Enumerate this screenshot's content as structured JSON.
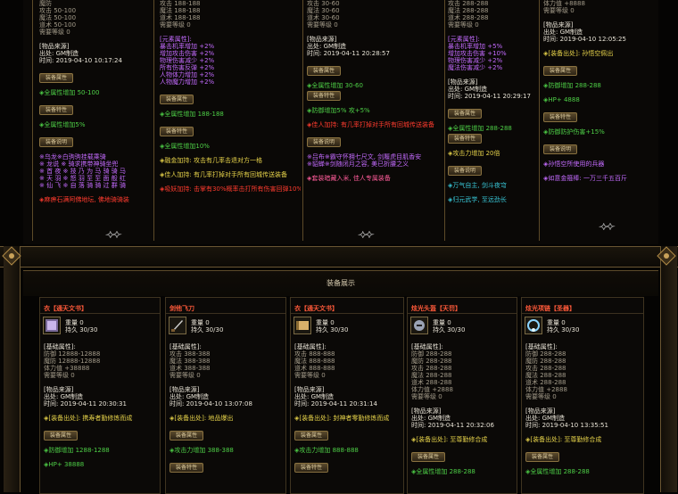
{
  "top_cols": [
    {
      "lines": [
        [
          "dim",
          "魔防"
        ],
        [
          "dim",
          "攻击          50-100"
        ],
        [
          "dim",
          "魔法          50-100"
        ],
        [
          "dim",
          "道术          50-100"
        ],
        [
          "dim",
          "需要等级        0"
        ],
        [
          "gap",
          ""
        ],
        [
          "white",
          "[物品来源]"
        ],
        [
          "white",
          "出处: GM制造"
        ],
        [
          "white",
          "时间: 2019-04-10 10:17:24"
        ],
        [
          "gap",
          ""
        ],
        [
          "btn",
          "装备属性"
        ],
        [
          "gap",
          ""
        ],
        [
          "green",
          "◈全属性增加 50-100"
        ],
        [
          "gap",
          ""
        ],
        [
          "btn",
          "装备特性"
        ],
        [
          "gap",
          ""
        ],
        [
          "green",
          "◈全属性增加5%"
        ],
        [
          "gap",
          ""
        ],
        [
          "btn",
          "装备说明"
        ],
        [
          "gap",
          ""
        ],
        [
          "purple",
          "※乌龙※白驹驹挂载乘骑"
        ],
        [
          "purple",
          "※ 龙说 ※ 骑求携带神骑坐兜"
        ],
        [
          "purple",
          "※ 首 夜 ※ 技 乃 为 马 骑 骑 马"
        ],
        [
          "purple",
          "※ 天 羽 ※ 怒 羽 至 至 面 般 红"
        ],
        [
          "purple",
          "※ 仙 飞 ※ 自 落 骑 骑 过 群 骑"
        ],
        [
          "gap",
          ""
        ],
        [
          "red",
          "◈麻痹石满阿佛地坛, 佛地骑骑装"
        ]
      ]
    },
    {
      "lines": [
        [
          "dim",
          "攻击          188-188"
        ],
        [
          "dim",
          "魔法          188-188"
        ],
        [
          "dim",
          "道术          188-188"
        ],
        [
          "dim",
          "需要等级        0"
        ],
        [
          "gap",
          ""
        ],
        [
          "purple",
          "[元素属性]:"
        ],
        [
          "purple",
          "暴击机率增加   +2%"
        ],
        [
          "purple",
          "增加攻击伤害   +2%"
        ],
        [
          "purple",
          "物理伤害减少   +2%"
        ],
        [
          "purple",
          "所有伤害反弹   +2%"
        ],
        [
          "purple",
          "人物体力增加   +2%"
        ],
        [
          "purple",
          "人物魔力增加   +2%"
        ],
        [
          "gap",
          ""
        ],
        [
          "btn",
          "装备属性"
        ],
        [
          "gap",
          ""
        ],
        [
          "green",
          "◈全属性增加 188-188"
        ],
        [
          "gap",
          ""
        ],
        [
          "btn",
          "装备特性"
        ],
        [
          "gap",
          ""
        ],
        [
          "green",
          "◈全属性增加10%"
        ],
        [
          "gap",
          ""
        ],
        [
          "yellow",
          "◈融金加持: 攻击有几率击退对方一格"
        ],
        [
          "gap",
          ""
        ],
        [
          "yellow",
          "◈佳人加持: 有几率打掉对手所有回城传送装备"
        ],
        [
          "gap",
          ""
        ],
        [
          "red",
          "◈吸妖加持: 击掌有30%概率击打所有伤害回弹10%"
        ]
      ]
    },
    {
      "lines": [
        [
          "dim",
          "攻击          30-60"
        ],
        [
          "dim",
          "魔法          30-60"
        ],
        [
          "dim",
          "道术          30-60"
        ],
        [
          "dim",
          "需要等级        0"
        ],
        [
          "gap",
          ""
        ],
        [
          "white",
          "[物品来源]"
        ],
        [
          "white",
          "出处: GM制造"
        ],
        [
          "white",
          "时间: 2019-04-11 20:28:57"
        ],
        [
          "gap",
          ""
        ],
        [
          "btn",
          "装备属性"
        ],
        [
          "gap",
          ""
        ],
        [
          "green",
          "◈全属性增加 30-60"
        ],
        [
          "btn",
          "装备特性"
        ],
        [
          "gap",
          ""
        ],
        [
          "green",
          "◈防御增加5% 攻+5%"
        ],
        [
          "gap",
          ""
        ],
        [
          "red",
          "◈佳人加持: 有几率打掉对手所有回城传送装备"
        ],
        [
          "gap",
          ""
        ],
        [
          "btn",
          "装备说明"
        ],
        [
          "gap",
          ""
        ],
        [
          "purple",
          "※吕布※霸守怀拥七尺文, 剑履虎目肌香安"
        ],
        [
          "purple",
          "※貂蝉※剑随闭月之容, 美已折腰之义"
        ],
        [
          "gap",
          ""
        ],
        [
          "pink",
          "◈套装暗藏入米, 佳人专属装备"
        ]
      ]
    },
    {
      "lines": [
        [
          "dim",
          "攻击          288-288"
        ],
        [
          "dim",
          "魔法          288-288"
        ],
        [
          "dim",
          "道术          288-288"
        ],
        [
          "dim",
          "需要等级        0"
        ],
        [
          "gap",
          ""
        ],
        [
          "purple",
          "[元素属性]:"
        ],
        [
          "purple",
          "暴击机率增加   +5%"
        ],
        [
          "purple",
          "增加攻击伤害   +10%"
        ],
        [
          "purple",
          "物理伤害减少   +2%"
        ],
        [
          "purple",
          "魔法伤害减少   +2%"
        ],
        [
          "gap",
          ""
        ],
        [
          "white",
          "[物品来源]"
        ],
        [
          "white",
          "出处: GM制造"
        ],
        [
          "white",
          "时间: 2019-04-11 20:29:17"
        ],
        [
          "gap",
          ""
        ],
        [
          "btn",
          "装备属性"
        ],
        [
          "gap",
          ""
        ],
        [
          "green",
          "◈全属性增加 288-288"
        ],
        [
          "btn",
          "装备特性"
        ],
        [
          "gap",
          ""
        ],
        [
          "yellow",
          "◈攻击力增加 20倍"
        ],
        [
          "gap",
          ""
        ],
        [
          "btn",
          "装备说明"
        ],
        [
          "gap",
          ""
        ],
        [
          "cyan",
          "◈万气自主, 剑斗夜穹"
        ],
        [
          "gap",
          ""
        ],
        [
          "cyan",
          "◈归元武学, 至远劲长"
        ]
      ]
    },
    {
      "lines": [
        [
          "dim",
          "体力值        +8888"
        ],
        [
          "dim",
          "需要等级        0"
        ],
        [
          "gap",
          ""
        ],
        [
          "white",
          "[物品来源]"
        ],
        [
          "white",
          "出处: GM制造"
        ],
        [
          "white",
          "时间: 2019-04-10 12:05:25"
        ],
        [
          "gap",
          ""
        ],
        [
          "yellow",
          "◈[装备出处]: 孙悟空佩出"
        ],
        [
          "gap",
          ""
        ],
        [
          "btn",
          "装备属性"
        ],
        [
          "gap",
          ""
        ],
        [
          "green",
          "◈防御增加 288-288"
        ],
        [
          "gap",
          ""
        ],
        [
          "green",
          "◈HP+ 4888"
        ],
        [
          "gap",
          ""
        ],
        [
          "btn",
          "装备特性"
        ],
        [
          "gap",
          ""
        ],
        [
          "green",
          "◈防御防护伤害+15%"
        ],
        [
          "gap",
          ""
        ],
        [
          "btn",
          "装备说明"
        ],
        [
          "gap",
          ""
        ],
        [
          "purple",
          "◈孙悟空所使用的兵器"
        ],
        [
          "gap",
          ""
        ],
        [
          "purple",
          "◈如意金箍棒: 一万三千五百斤"
        ]
      ]
    }
  ],
  "section_title": "装备展示",
  "cards": [
    {
      "name": "衣【通天文书】",
      "icon": "book-icon",
      "meta": [
        "重量 0",
        "持久 30/30"
      ],
      "lines": [
        [
          "white",
          "[基础属性]:"
        ],
        [
          "dim",
          "防御          12888-12888"
        ],
        [
          "dim",
          "魔防          12888-12888"
        ],
        [
          "dim",
          "体力值        +38888"
        ],
        [
          "dim",
          "需要等级        0"
        ],
        [
          "gap",
          ""
        ],
        [
          "white",
          "[物品来源]"
        ],
        [
          "white",
          "出处: GM制造"
        ],
        [
          "white",
          "时间: 2019-04-11 20:30:31"
        ],
        [
          "gap",
          ""
        ],
        [
          "yellow",
          "◈[装备出处]: 携寿者勤修炼而成"
        ],
        [
          "gap",
          ""
        ],
        [
          "btn",
          "装备属性"
        ],
        [
          "gap",
          ""
        ],
        [
          "green",
          "◈防御增加 1288-1288"
        ],
        [
          "gap",
          ""
        ],
        [
          "green",
          "◈HP+ 38888"
        ]
      ]
    },
    {
      "name": "剑他飞刀",
      "icon": "dagger-icon",
      "meta": [
        "重量 0",
        "持久 30/30"
      ],
      "lines": [
        [
          "white",
          "[基础属性]:"
        ],
        [
          "dim",
          "攻击          388-388"
        ],
        [
          "dim",
          "魔法          388-388"
        ],
        [
          "dim",
          "道术          388-388"
        ],
        [
          "dim",
          "需要等级        0"
        ],
        [
          "gap",
          ""
        ],
        [
          "white",
          "[物品来源]"
        ],
        [
          "white",
          "出处: GM制造"
        ],
        [
          "white",
          "时间: 2019-04-10 13:07:08"
        ],
        [
          "gap",
          ""
        ],
        [
          "yellow",
          "◈[装备出处]: 地品爆出"
        ],
        [
          "gap",
          ""
        ],
        [
          "btn",
          "装备属性"
        ],
        [
          "gap",
          ""
        ],
        [
          "green",
          "◈攻击力增加 388-388"
        ],
        [
          "gap",
          ""
        ],
        [
          "btn",
          "装备特性"
        ]
      ]
    },
    {
      "name": "衣【通天文书】",
      "icon": "scroll-icon",
      "meta": [
        "重量 0",
        "持久 30/30"
      ],
      "lines": [
        [
          "white",
          "[基础属性]:"
        ],
        [
          "dim",
          "攻击          888-888"
        ],
        [
          "dim",
          "魔法          888-888"
        ],
        [
          "dim",
          "道术          888-888"
        ],
        [
          "dim",
          "需要等级        0"
        ],
        [
          "gap",
          ""
        ],
        [
          "white",
          "[物品来源]"
        ],
        [
          "white",
          "出处: GM制造"
        ],
        [
          "white",
          "时间: 2019-04-11 20:31:14"
        ],
        [
          "gap",
          ""
        ],
        [
          "yellow",
          "◈[装备出处]: 封神者零勤修炼而成"
        ],
        [
          "gap",
          ""
        ],
        [
          "btn",
          "装备属性"
        ],
        [
          "gap",
          ""
        ],
        [
          "green",
          "◈攻击力增加 888-888"
        ],
        [
          "gap",
          ""
        ],
        [
          "btn",
          "装备特性"
        ]
      ]
    },
    {
      "name": "炫光头盔【天罚】",
      "icon": "helmet-icon",
      "meta": [
        "重量 0",
        "持久 30/30"
      ],
      "lines": [
        [
          "white",
          "[基础属性]:"
        ],
        [
          "dim",
          "防御          288-288"
        ],
        [
          "dim",
          "魔防          288-288"
        ],
        [
          "dim",
          "攻击          288-288"
        ],
        [
          "dim",
          "魔法          288-288"
        ],
        [
          "dim",
          "道术          288-288"
        ],
        [
          "dim",
          "体力值        +2888"
        ],
        [
          "dim",
          "需要等级        0"
        ],
        [
          "gap",
          ""
        ],
        [
          "white",
          "[物品来源]"
        ],
        [
          "white",
          "出处: GM制造"
        ],
        [
          "white",
          "时间: 2019-04-11 20:32:06"
        ],
        [
          "gap",
          ""
        ],
        [
          "yellow",
          "◈[装备出处]: 至尊勤修合成"
        ],
        [
          "gap",
          ""
        ],
        [
          "btn",
          "装备属性"
        ],
        [
          "gap",
          ""
        ],
        [
          "green",
          "◈全属性增加 288-288"
        ]
      ]
    },
    {
      "name": "炫光项链【圣器】",
      "icon": "necklace-icon",
      "meta": [
        "重量 0",
        "持久 30/30"
      ],
      "lines": [
        [
          "white",
          "[基础属性]:"
        ],
        [
          "dim",
          "防御          288-288"
        ],
        [
          "dim",
          "魔防          288-288"
        ],
        [
          "dim",
          "攻击          288-288"
        ],
        [
          "dim",
          "魔法          288-288"
        ],
        [
          "dim",
          "道术          288-288"
        ],
        [
          "dim",
          "体力值        +2888"
        ],
        [
          "dim",
          "需要等级        0"
        ],
        [
          "gap",
          ""
        ],
        [
          "white",
          "[物品来源]"
        ],
        [
          "white",
          "出处: GM制造"
        ],
        [
          "white",
          "时间: 2019-04-10 13:35:51"
        ],
        [
          "gap",
          ""
        ],
        [
          "yellow",
          "◈[装备出处]: 至尊勤修合成"
        ],
        [
          "gap",
          ""
        ],
        [
          "btn",
          "装备属性"
        ],
        [
          "gap",
          ""
        ],
        [
          "green",
          "◈全属性增加 288-288"
        ]
      ]
    }
  ]
}
